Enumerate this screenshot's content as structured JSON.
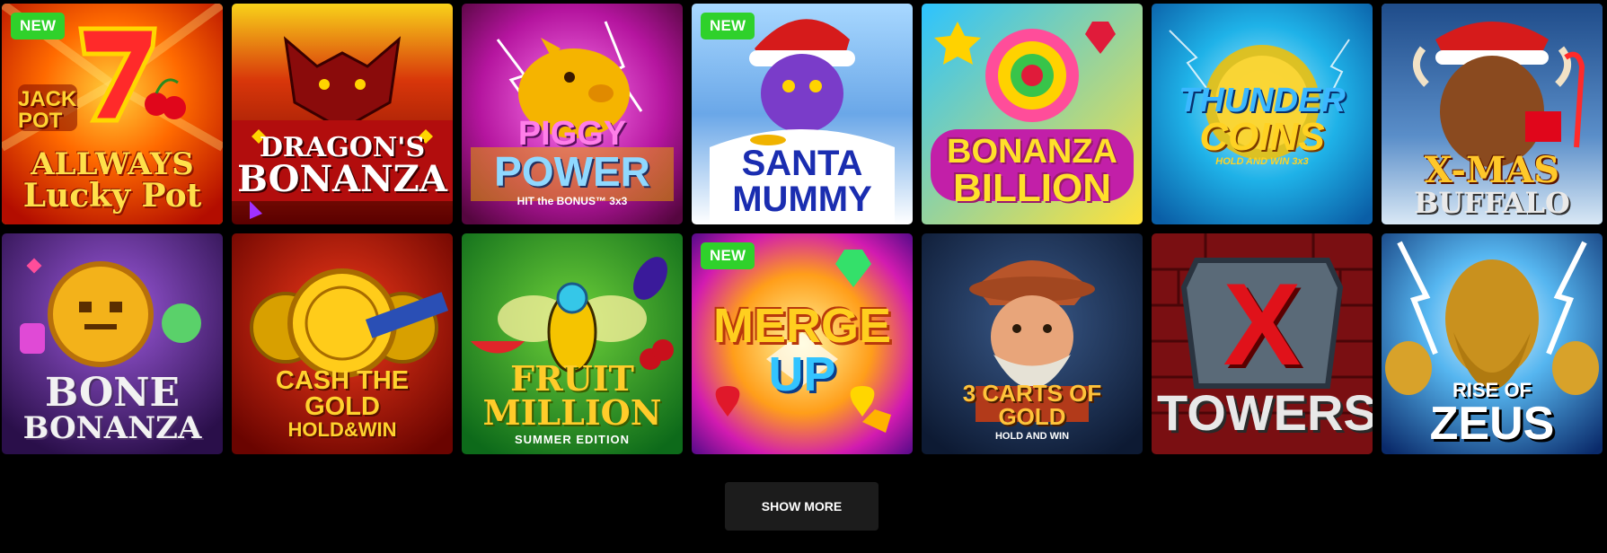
{
  "badge_label": "NEW",
  "games": [
    {
      "lines": [
        "ALLWAYS",
        "Lucky Pot"
      ],
      "sub": "JACK POT"
    },
    {
      "lines": [
        "DRAGON'S",
        "BONANZA"
      ]
    },
    {
      "lines": [
        "PIGGY",
        "POWER",
        "HIT the BONUS™ 3x3"
      ]
    },
    {
      "lines": [
        "SANTA",
        "MUMMY"
      ]
    },
    {
      "lines": [
        "BONANZA",
        "BILLION"
      ]
    },
    {
      "lines": [
        "THUNDER",
        "COINS",
        "HOLD AND WIN 3x3"
      ]
    },
    {
      "lines": [
        "X-MAS",
        "BUFFALO"
      ]
    },
    {
      "lines": [
        "BONE",
        "BONANZA"
      ]
    },
    {
      "lines": [
        "CASH THE GOLD",
        "HOLD&WIN"
      ]
    },
    {
      "lines": [
        "FRUIT",
        "MILLION",
        "SUMMER EDITION"
      ]
    },
    {
      "lines": [
        "MERGE",
        "UP"
      ]
    },
    {
      "lines": [
        "3 CARTS OF GOLD",
        "HOLD AND WIN"
      ]
    },
    {
      "lines": [
        "TOWERS"
      ],
      "sub": "X"
    },
    {
      "lines": [
        "RISE OF",
        "ZEUS"
      ]
    }
  ],
  "show_more_label": "SHOW MORE"
}
